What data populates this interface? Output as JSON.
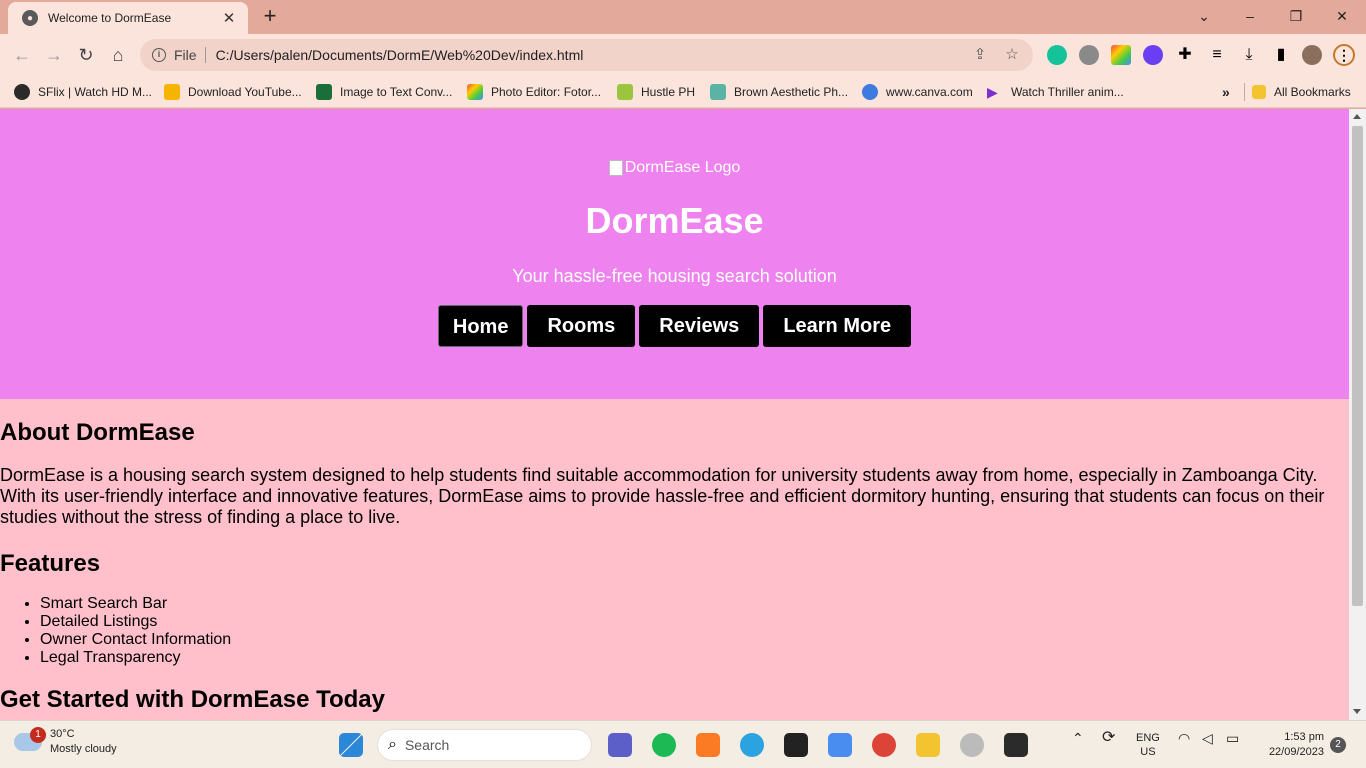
{
  "browser": {
    "tab_title": "Welcome to DormEase",
    "new_tab": "+",
    "close_tab": "✕",
    "window_controls": {
      "dropdown": "⌄",
      "minimize": "–",
      "restore": "❐",
      "close": "✕"
    },
    "nav": {
      "back": "←",
      "forward": "→",
      "reload": "↻",
      "home": "⌂"
    },
    "address": {
      "scheme_label": "File",
      "url": "C:/Users/palen/Documents/DormE/Web%20Dev/index.html"
    },
    "bookmarks": [
      {
        "label": "SFlix | Watch HD M...",
        "icon": "sflix-icon",
        "color": "#2a2a2a"
      },
      {
        "label": "Download YouTube...",
        "icon": "download-youtube-icon",
        "color": "#f5b400"
      },
      {
        "label": "Image to Text Conv...",
        "icon": "image-to-text-icon",
        "color": "#1b6e3a"
      },
      {
        "label": "Photo Editor: Fotor...",
        "icon": "fotor-icon",
        "color": "#e84c88"
      },
      {
        "label": "Hustle PH",
        "icon": "hustle-icon",
        "color": "#9bc53d"
      },
      {
        "label": "Brown Aesthetic Ph...",
        "icon": "brown-aesthetic-icon",
        "color": "#5bb3a5"
      },
      {
        "label": "www.canva.com",
        "icon": "canva-icon",
        "color": "#3d7be0"
      },
      {
        "label": "Watch Thriller anim...",
        "icon": "play-icon",
        "color": "#7b2fd0"
      }
    ],
    "bookmarks_more": "»",
    "all_bookmarks": "All Bookmarks"
  },
  "page": {
    "logo_alt": "DormEase Logo",
    "site_title": "DormEase",
    "tagline": "Your hassle-free housing search solution",
    "nav": [
      "Home",
      "Rooms",
      "Reviews",
      "Learn More"
    ],
    "about_heading": "About DormEase",
    "about_text": "DormEase is a housing search system designed to help students find suitable accommodation for university students away from home, especially in Zamboanga City. With its user-friendly interface and innovative features, DormEase aims to provide hassle-free and efficient dormitory hunting, ensuring that students can focus on their studies without the stress of finding a place to live.",
    "features_heading": "Features",
    "features": [
      "Smart Search Bar",
      "Detailed Listings",
      "Owner Contact Information",
      "Legal Transparency"
    ],
    "started_heading": "Get Started with DormEase Today"
  },
  "colors": {
    "header_bg": "#ee82ee",
    "content_bg": "#ffc0cb",
    "nav_bg": "#000000",
    "chrome_bg": "#e3a99a"
  },
  "taskbar": {
    "weather_temp": "30°C",
    "weather_desc": "Mostly cloudy",
    "weather_badge": "1",
    "search_label": "Search",
    "lang_top": "ENG",
    "lang_bottom": "US",
    "time": "1:53 pm",
    "date": "22/09/2023",
    "notifications": "2"
  }
}
